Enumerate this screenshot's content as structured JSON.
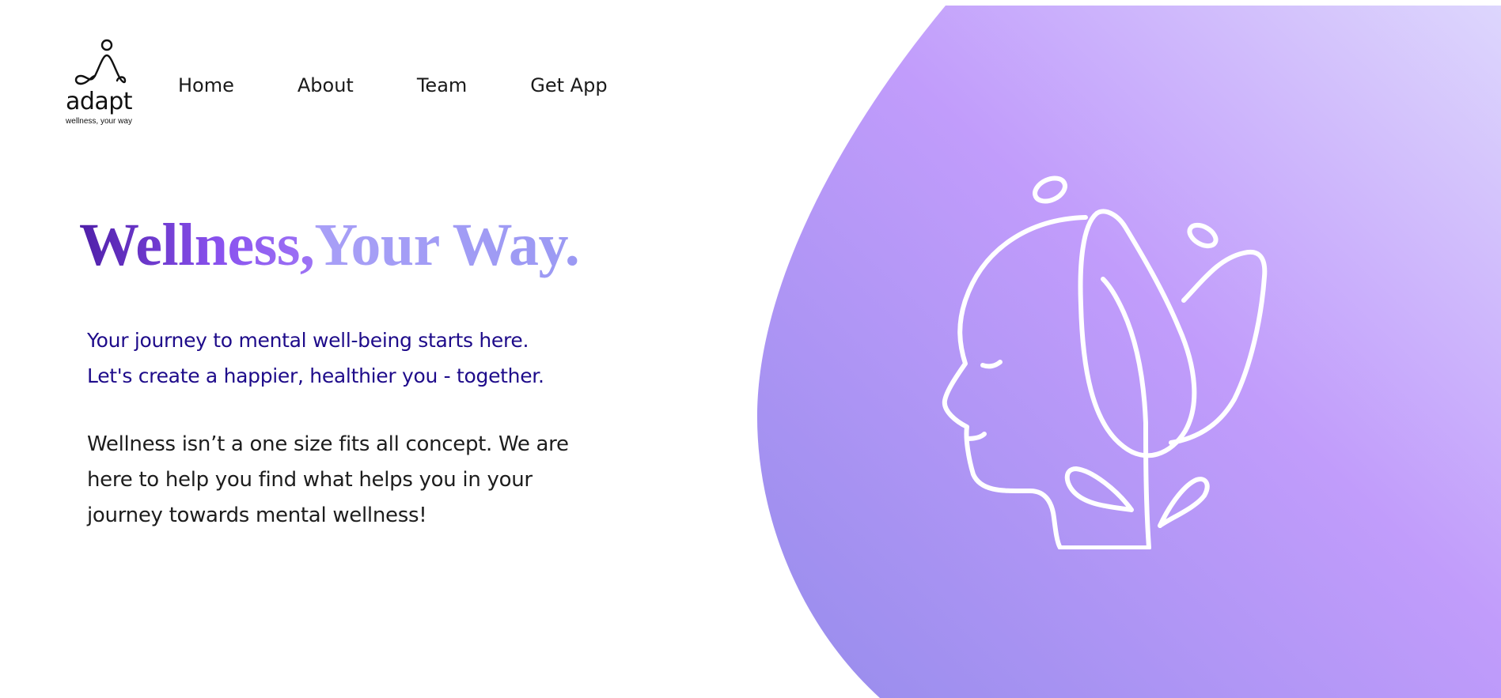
{
  "brand": {
    "name": "adapt",
    "tagline": "wellness, your way",
    "logo_icon": "figure-wave-icon"
  },
  "nav": {
    "items": [
      {
        "label": "Home"
      },
      {
        "label": "About"
      },
      {
        "label": "Team"
      },
      {
        "label": "Get App"
      }
    ]
  },
  "hero": {
    "title_part1": "Wellness,",
    "title_part2": "Your Way.",
    "subtitle_line1": "Your journey to mental well-being starts here.",
    "subtitle_line2": "Let's create a happier, healthier you - together.",
    "body_line1": "Wellness isn’t a one size fits all concept. We are",
    "body_line2": "here to help you find what helps you in your",
    "body_line3": "journey towards mental wellness!",
    "illustration_icon": "head-with-leaf-icon"
  },
  "colors": {
    "accent_dark": "#4f1fa8",
    "accent_light": "#a89ff7",
    "subtitle": "#1e0b8a",
    "blob_start": "#968cec",
    "blob_end": "#ddd6fd"
  }
}
